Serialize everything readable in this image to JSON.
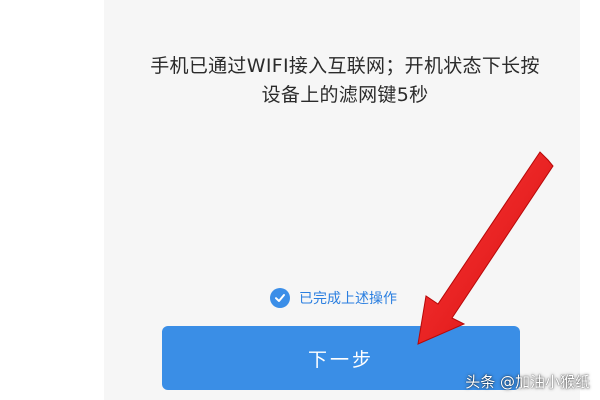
{
  "instruction": {
    "line1": "手机已通过WIFI接入互联网；开机状态下长按",
    "line2": "设备上的滤网键5秒"
  },
  "confirm": {
    "label": "已完成上述操作",
    "checked": true,
    "icon": "check-circle-icon"
  },
  "next_button": {
    "label": "下一步"
  },
  "annotation": {
    "icon": "red-arrow-icon",
    "color": "#e81e1e"
  },
  "watermark": {
    "text": "头条 @加油小猴纸"
  },
  "colors": {
    "accent": "#3a8ee6",
    "text": "#2b2b2b",
    "link": "#2b7fe0"
  }
}
